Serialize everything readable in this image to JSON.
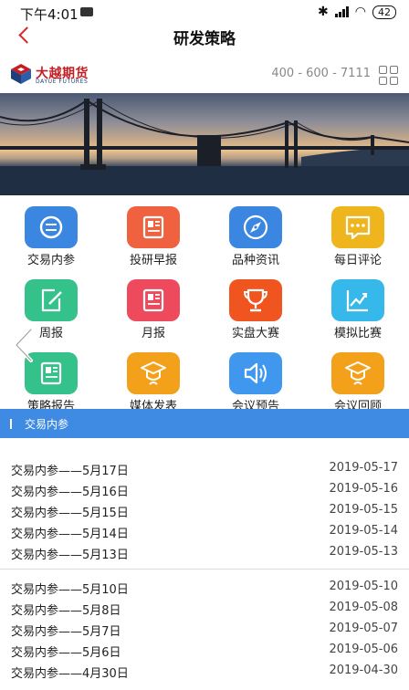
{
  "status_bar": {
    "time": "下午4:01",
    "battery": "42",
    "bluetooth": "✱",
    "wifi": "◠"
  },
  "nav": {
    "title": "研发策略"
  },
  "brand": {
    "name_cn": "大越期货",
    "name_en": "DAYUE FUTURES",
    "phone": "400 - 600 - 7111"
  },
  "features": [
    {
      "label": "交易内参",
      "icon": "minus-circle-icon",
      "color": "#3a86e0"
    },
    {
      "label": "投研早报",
      "icon": "newspaper-icon",
      "color": "#f0623f"
    },
    {
      "label": "品种资讯",
      "icon": "compass-icon",
      "color": "#3a86e0"
    },
    {
      "label": "每日评论",
      "icon": "chat-icon",
      "color": "#efb51d"
    },
    {
      "label": "周报",
      "icon": "edit-icon",
      "color": "#34c28a"
    },
    {
      "label": "月报",
      "icon": "newspaper-icon",
      "color": "#ee4a5d"
    },
    {
      "label": "实盘大赛",
      "icon": "trophy-icon",
      "color": "#f0541f"
    },
    {
      "label": "模拟比赛",
      "icon": "chart-icon",
      "color": "#37b8ea"
    },
    {
      "label": "策略报告",
      "icon": "report-icon",
      "color": "#34c28a"
    },
    {
      "label": "媒体发表",
      "icon": "graduate-icon",
      "color": "#f3a01b"
    },
    {
      "label": "会议预告",
      "icon": "speaker-icon",
      "color": "#3f98ee"
    },
    {
      "label": "会议回顾",
      "icon": "graduate-icon",
      "color": "#f3a01b"
    }
  ],
  "section": {
    "title": "交易内参"
  },
  "articles": [
    {
      "title": "交易内参——5月17日",
      "date": "2019-05-17"
    },
    {
      "title": "交易内参——5月16日",
      "date": "2019-05-16"
    },
    {
      "title": "交易内参——5月15日",
      "date": "2019-05-15"
    },
    {
      "title": "交易内参——5月14日",
      "date": "2019-05-14"
    },
    {
      "title": "交易内参——5月13日",
      "date": "2019-05-13"
    },
    {
      "title": "交易内参——5月10日",
      "date": "2019-05-10"
    },
    {
      "title": "交易内参——5月8日",
      "date": "2019-05-08"
    },
    {
      "title": "交易内参——5月7日",
      "date": "2019-05-07"
    },
    {
      "title": "交易内参——5月6日",
      "date": "2019-05-06"
    },
    {
      "title": "交易内参——4月30日",
      "date": "2019-04-30"
    }
  ]
}
